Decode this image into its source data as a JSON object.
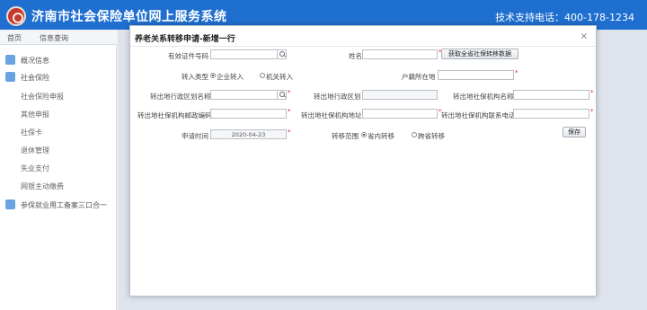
{
  "header": {
    "title": "济南市社会保险单位网上服务系统",
    "support": "技术支持电话：400-178-1234"
  },
  "tabs": [
    "首页",
    "信息查询"
  ],
  "sidebar": {
    "items": [
      {
        "label": "概况信息",
        "icon": "home-icon"
      },
      {
        "label": "社会保险",
        "icon": "edit-icon"
      },
      {
        "label": "社会保险申报"
      },
      {
        "label": "其他申报"
      },
      {
        "label": "社保卡"
      },
      {
        "label": "退休管理"
      },
      {
        "label": "失业支付"
      },
      {
        "label": "网银主动缴费"
      },
      {
        "label": "参保就业用工备案三口合一",
        "icon": "edit-icon"
      }
    ]
  },
  "dialog": {
    "title": "养老关系转移申请-新增一行",
    "close": "×",
    "fields": {
      "id_no": {
        "label": "有效证件号码",
        "value": ""
      },
      "name": {
        "label": "姓名",
        "value": ""
      },
      "fetch_btn": "获取全省社保转移数据",
      "transfer_in_type": {
        "label": "转入类型",
        "options": [
          "企业转入",
          "机关转入"
        ],
        "selected": "企业转入"
      },
      "hukou": {
        "label": "户籍所在地",
        "value": ""
      },
      "out_region_name": {
        "label": "转出地行政区划名称",
        "value": ""
      },
      "out_region": {
        "label": "转出地行政区划",
        "value": ""
      },
      "out_org_name": {
        "label": "转出地社保机构名称",
        "value": ""
      },
      "out_org_postcode": {
        "label": "转出地社保机构邮政编码",
        "value": ""
      },
      "out_org_addr": {
        "label": "转出地社保机构地址",
        "value": ""
      },
      "out_org_phone": {
        "label": "转出地社保机构联系电话",
        "value": ""
      },
      "apply_time": {
        "label": "申请时间",
        "value": "2020-04-23"
      },
      "scope": {
        "label": "转移范围",
        "options": [
          "省内转移",
          "跨省转移"
        ],
        "selected": "省内转移"
      },
      "save_btn": "保存"
    }
  },
  "colors": {
    "header": "#1f6fd0",
    "required": "#e02222"
  }
}
